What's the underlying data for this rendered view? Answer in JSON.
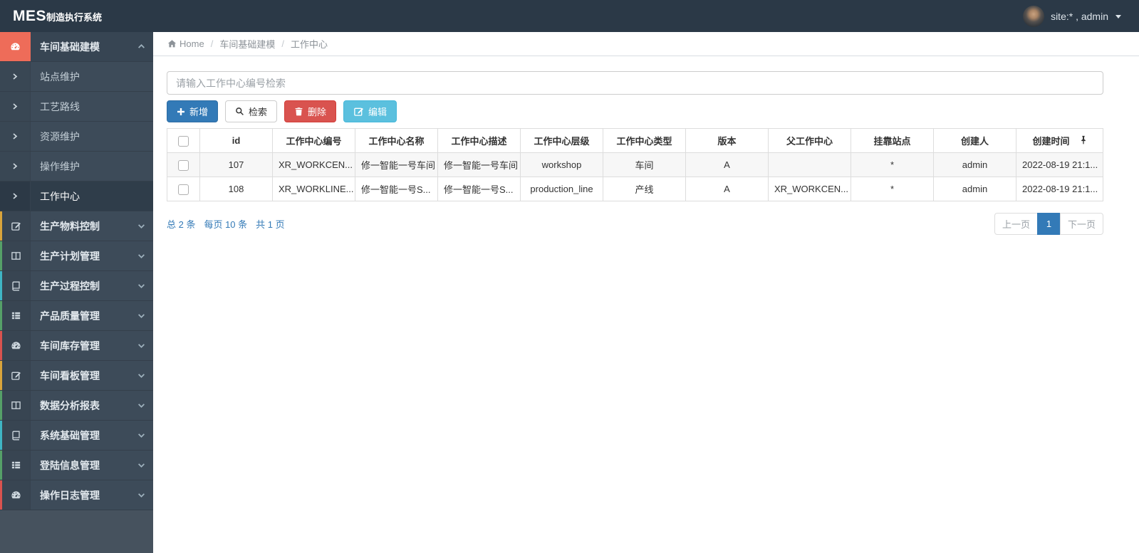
{
  "topbar": {
    "logo_bold": "MES",
    "logo_suffix": "制造执行系统",
    "user_label": "site:* , admin"
  },
  "breadcrumb": {
    "items": [
      {
        "label": "Home",
        "icon": "home-icon",
        "link": true
      },
      {
        "label": "车间基础建模",
        "link": true
      },
      {
        "label": "工作中心",
        "link": false
      }
    ]
  },
  "sidebar": {
    "root": {
      "label": "车间基础建模",
      "icon": "dashboard-icon",
      "expanded": true,
      "icon_bg": "#ee6c59"
    },
    "sub_items": [
      {
        "label": "站点维护",
        "active": false
      },
      {
        "label": "工艺路线",
        "active": false
      },
      {
        "label": "资源维护",
        "active": false
      },
      {
        "label": "操作维护",
        "active": false
      },
      {
        "label": "工作中心",
        "active": true
      }
    ],
    "items": [
      {
        "label": "生产物料控制",
        "icon": "edit-icon",
        "accent": "#d9a43b"
      },
      {
        "label": "生产计划管理",
        "icon": "columns-icon",
        "accent": "#55a068"
      },
      {
        "label": "生产过程控制",
        "icon": "book-icon",
        "accent": "#3fb5c4"
      },
      {
        "label": "产品质量管理",
        "icon": "list-icon",
        "accent": "#55a068"
      },
      {
        "label": "车间库存管理",
        "icon": "dashboard-icon",
        "accent": "#d9534f"
      },
      {
        "label": "车间看板管理",
        "icon": "edit-icon",
        "accent": "#d9a43b"
      },
      {
        "label": "数据分析报表",
        "icon": "columns-icon",
        "accent": "#55a068"
      },
      {
        "label": "系统基础管理",
        "icon": "book-icon",
        "accent": "#3fb5c4"
      },
      {
        "label": "登陆信息管理",
        "icon": "list-icon",
        "accent": "#55a068"
      },
      {
        "label": "操作日志管理",
        "icon": "dashboard-icon",
        "accent": "#d9534f"
      }
    ]
  },
  "search": {
    "placeholder": "请输入工作中心编号检索",
    "value": ""
  },
  "toolbar": {
    "add_label": "新增",
    "search_label": "检索",
    "delete_label": "删除",
    "edit_label": "编辑"
  },
  "table": {
    "headers": [
      "id",
      "工作中心编号",
      "工作中心名称",
      "工作中心描述",
      "工作中心层级",
      "工作中心类型",
      "版本",
      "父工作中心",
      "挂靠站点",
      "创建人",
      "创建时间"
    ],
    "rows": [
      {
        "checked": false,
        "cells": [
          "107",
          "XR_WORKCEN...",
          "修一智能一号车间",
          "修一智能一号车间",
          "workshop",
          "车间",
          "A",
          "",
          "*",
          "admin",
          "2022-08-19 21:1..."
        ]
      },
      {
        "checked": false,
        "cells": [
          "108",
          "XR_WORKLINE...",
          "修一智能一号S...",
          "修一智能一号S...",
          "production_line",
          "产线",
          "A",
          "XR_WORKCEN...",
          "*",
          "admin",
          "2022-08-19 21:1..."
        ]
      }
    ]
  },
  "pagination": {
    "summary_total": "总 2 条",
    "summary_per_page": "每页 10 条",
    "summary_pages": "共 1 页",
    "prev_label": "上一页",
    "current_page": "1",
    "next_label": "下一页"
  },
  "colors": {
    "topbar_bg": "#2b3947",
    "sidebar_bg": "#46525e",
    "sidebar_item_bg": "#3d4b59",
    "active_icon_bg": "#ee6c59",
    "primary": "#337ab7",
    "danger": "#d9534f",
    "info": "#5bc0de",
    "link": "#337ab7"
  }
}
